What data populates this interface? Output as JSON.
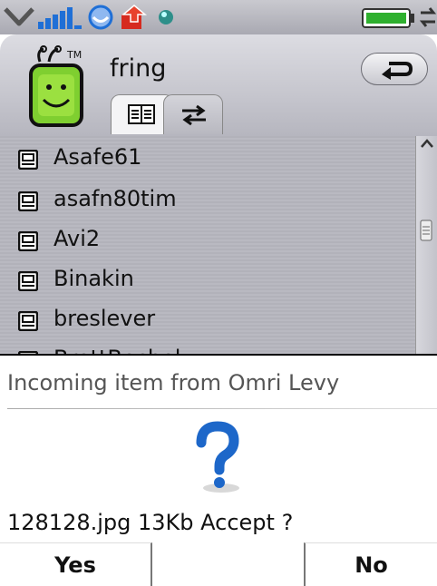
{
  "status_bar": {
    "icons": [
      "signal-down-icon",
      "signal-strength-icon",
      "connection-icon",
      "upload-icon",
      "status-dot-icon",
      "battery-icon",
      "sync-icon"
    ],
    "colors": {
      "signal": "#1f6fd6",
      "upload": "#d62a1f",
      "battery": "#2fb02f"
    }
  },
  "header": {
    "app_name": "fring",
    "back_icon": "back-arrow-icon",
    "tabs": [
      {
        "name": "contacts",
        "icon": "contact-list-icon",
        "active": true
      },
      {
        "name": "transfers",
        "icon": "transfer-arrows-icon",
        "active": false
      }
    ]
  },
  "contacts": {
    "items": [
      {
        "name": "Asafe61"
      },
      {
        "name": "asafn80tim"
      },
      {
        "name": "Avi2"
      },
      {
        "name": "Binakin"
      },
      {
        "name": "breslever"
      },
      {
        "name": "BrettBechel"
      }
    ],
    "icon": "contact-icon"
  },
  "dialog": {
    "title": "Incoming item from Omri Levy",
    "icon": "question-mark-icon",
    "message": "128128.jpg 13Kb Accept ?",
    "yes_label": "Yes",
    "no_label": "No",
    "accent": "#1d67c9"
  }
}
